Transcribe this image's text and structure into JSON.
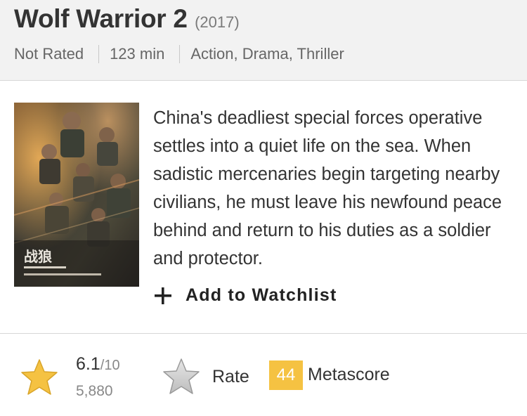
{
  "movie": {
    "title": "Wolf Warrior 2",
    "year": "(2017)",
    "rating_label": "Not Rated",
    "runtime": "123 min",
    "genres": "Action, Drama, Thriller",
    "summary": "China's deadliest special forces operative settles into a quiet life on the sea. When sadistic mercenaries begin targeting nearby civilians, he must leave his newfound peace behind and return to his duties as a soldier and protector."
  },
  "actions": {
    "watchlist_label": "Add to Watchlist",
    "rate_label": "Rate"
  },
  "ratings": {
    "score": "6.1",
    "score_max": "/10",
    "votes": "5,880",
    "metascore": "44",
    "metascore_label": "Metascore"
  },
  "colors": {
    "star": "#f5c242",
    "metascore_badge": "#f5c242",
    "header_bg": "#f2f2f2"
  },
  "icons": {
    "rating_star": "star-icon",
    "rate_star": "star-outline-icon",
    "watchlist": "plus-icon"
  }
}
